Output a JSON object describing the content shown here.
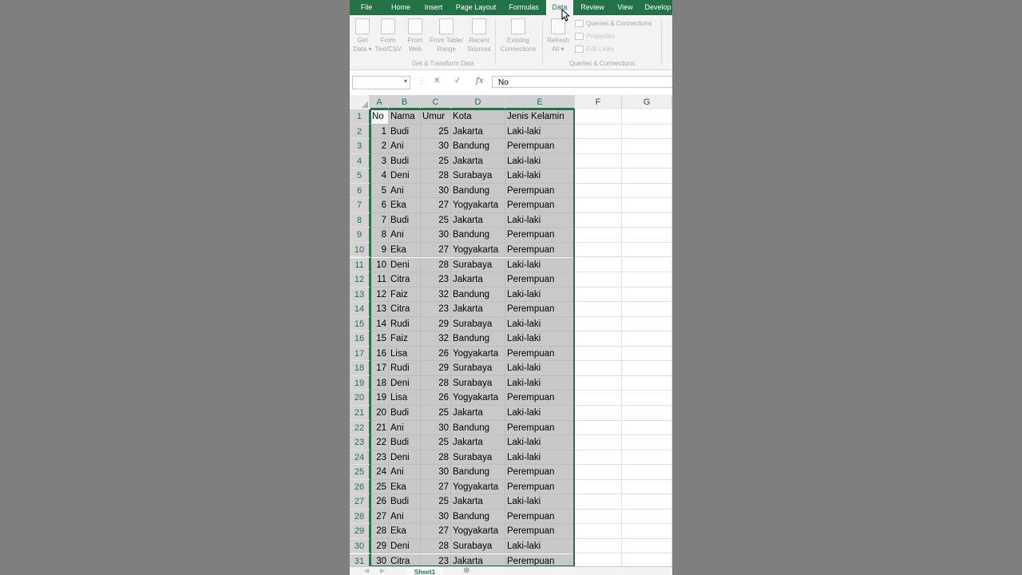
{
  "ribbon_tabs": [
    {
      "label": "File"
    },
    {
      "label": "Home"
    },
    {
      "label": "Insert"
    },
    {
      "label": "Page Layout"
    },
    {
      "label": "Formulas"
    },
    {
      "label": "Data",
      "active": true
    },
    {
      "label": "Review"
    },
    {
      "label": "View"
    },
    {
      "label": "Develop"
    }
  ],
  "ribbon": {
    "get_data": [
      "Get",
      "Data"
    ],
    "from_text": [
      "From",
      "Text/CSV"
    ],
    "from_web": [
      "From",
      "Web"
    ],
    "from_table": [
      "From Table/",
      "Range"
    ],
    "recent_sources": [
      "Recent",
      "Sources"
    ],
    "existing_connections": [
      "Existing",
      "Connections"
    ],
    "refresh_all": [
      "Refresh",
      "All"
    ],
    "queries_connections": "Queries & Connections",
    "properties": "Properties",
    "edit_links": "Edit Links",
    "group_get_transform": "Get & Transform Data",
    "group_queries": "Queries & Connections"
  },
  "formula_bar": {
    "name_box": "",
    "cancel_glyph": "✕",
    "enter_glyph": "✓",
    "fx_label": "fx",
    "value": "No"
  },
  "columns": [
    "A",
    "B",
    "C",
    "D",
    "E",
    "F",
    "G"
  ],
  "headers": [
    "No",
    "Nama",
    "Umur",
    "Kota",
    "Jenis Kelamin"
  ],
  "rows": [
    [
      1,
      "Budi",
      25,
      "Jakarta",
      "Laki-laki"
    ],
    [
      2,
      "Ani",
      30,
      "Bandung",
      "Perempuan"
    ],
    [
      3,
      "Budi",
      25,
      "Jakarta",
      "Laki-laki"
    ],
    [
      4,
      "Deni",
      28,
      "Surabaya",
      "Laki-laki"
    ],
    [
      5,
      "Ani",
      30,
      "Bandung",
      "Perempuan"
    ],
    [
      6,
      "Eka",
      27,
      "Yogyakarta",
      "Perempuan"
    ],
    [
      7,
      "Budi",
      25,
      "Jakarta",
      "Laki-laki"
    ],
    [
      8,
      "Ani",
      30,
      "Bandung",
      "Perempuan"
    ],
    [
      9,
      "Eka",
      27,
      "Yogyakarta",
      "Perempuan"
    ],
    [
      10,
      "Deni",
      28,
      "Surabaya",
      "Laki-laki"
    ],
    [
      11,
      "Citra",
      23,
      "Jakarta",
      "Perempuan"
    ],
    [
      12,
      "Faiz",
      32,
      "Bandung",
      "Laki-laki"
    ],
    [
      13,
      "Citra",
      23,
      "Jakarta",
      "Perempuan"
    ],
    [
      14,
      "Rudi",
      29,
      "Surabaya",
      "Laki-laki"
    ],
    [
      15,
      "Faiz",
      32,
      "Bandung",
      "Laki-laki"
    ],
    [
      16,
      "Lisa",
      26,
      "Yogyakarta",
      "Perempuan"
    ],
    [
      17,
      "Rudi",
      29,
      "Surabaya",
      "Laki-laki"
    ],
    [
      18,
      "Deni",
      28,
      "Surabaya",
      "Laki-laki"
    ],
    [
      19,
      "Lisa",
      26,
      "Yogyakarta",
      "Perempuan"
    ],
    [
      20,
      "Budi",
      25,
      "Jakarta",
      "Laki-laki"
    ],
    [
      21,
      "Ani",
      30,
      "Bandung",
      "Perempuan"
    ],
    [
      22,
      "Budi",
      25,
      "Jakarta",
      "Laki-laki"
    ],
    [
      23,
      "Deni",
      28,
      "Surabaya",
      "Laki-laki"
    ],
    [
      24,
      "Ani",
      30,
      "Bandung",
      "Perempuan"
    ],
    [
      25,
      "Eka",
      27,
      "Yogyakarta",
      "Perempuan"
    ],
    [
      26,
      "Budi",
      25,
      "Jakarta",
      "Laki-laki"
    ],
    [
      27,
      "Ani",
      30,
      "Bandung",
      "Perempuan"
    ],
    [
      28,
      "Eka",
      27,
      "Yogyakarta",
      "Perempuan"
    ],
    [
      29,
      "Deni",
      28,
      "Surabaya",
      "Laki-laki"
    ],
    [
      30,
      "Citra",
      23,
      "Jakarta",
      "Perempuan"
    ]
  ],
  "sheet_tabs": {
    "active": "Sheet1",
    "add_glyph": "⊕",
    "prev_glyph": "◀",
    "next_glyph": "▶"
  },
  "colors": {
    "accent": "#217346",
    "selection": "#c8c8c8",
    "background": "#7f7f7f"
  }
}
